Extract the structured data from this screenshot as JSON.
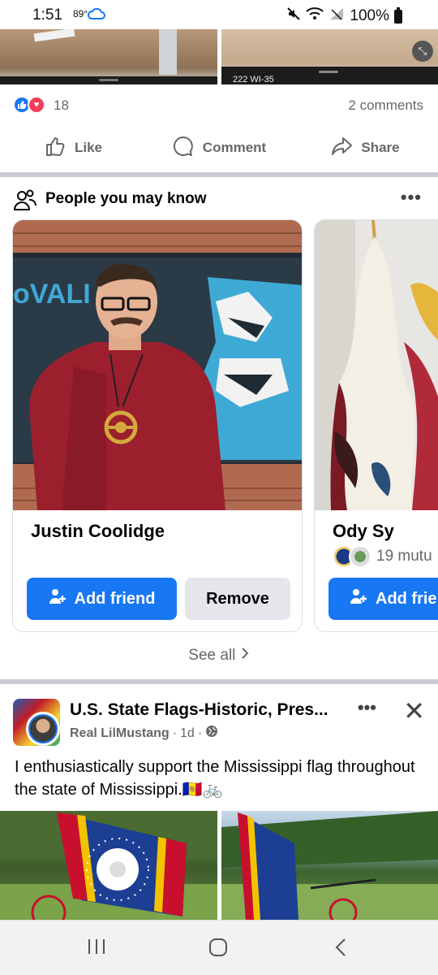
{
  "status_bar": {
    "time": "1:51",
    "temperature": "89°",
    "battery": "100%"
  },
  "top_photos": {
    "sign_text": "222 WI-35"
  },
  "post_stats": {
    "reaction_count": "18",
    "comments": "2 comments"
  },
  "actions": {
    "like": "Like",
    "comment": "Comment",
    "share": "Share"
  },
  "pymk": {
    "title": "People you may know",
    "cards": [
      {
        "name": "Justin Coolidge",
        "add_label": "Add friend",
        "remove_label": "Remove",
        "poster_text": "oVALI"
      },
      {
        "name": "Ody Sy",
        "mutuals": "19 mutu",
        "add_label": "Add frie"
      }
    ],
    "see_all": "See all"
  },
  "post": {
    "group_name": "U.S. State Flags-Historic, Pres...",
    "author": "Real LilMustang",
    "time": "1d",
    "text": "I enthusiastically support the Mississippi flag throughout the state of Mississippi.🇦🇩🚲"
  },
  "colors": {
    "accent": "#1877f2",
    "love": "#f33e58",
    "secondary_button": "#e4e6eb",
    "muted_text": "#65676b"
  }
}
